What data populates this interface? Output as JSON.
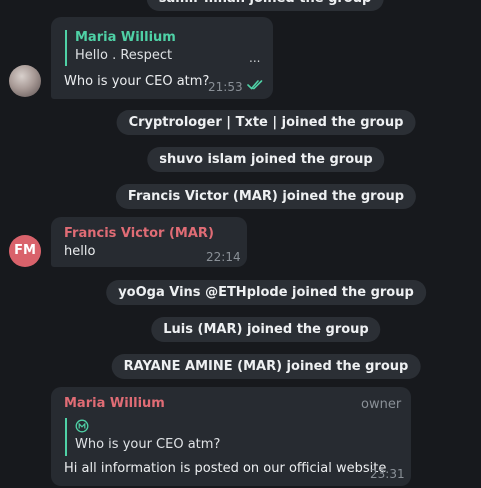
{
  "service": {
    "top_partial": "samir mnan joined the group",
    "msg1": "Cryptrologer | Txte | joined the group",
    "msg2": "shuvo islam joined the group",
    "msg3": "Francis Victor (MAR) joined the group",
    "msg4": "yoOga Vins @ETHplode joined the group",
    "msg5": "Luis (MAR) joined the group",
    "msg6": "RAYANE AMINE (MAR) joined the group"
  },
  "message1": {
    "quote_name": "Maria Willium",
    "quote_text": "Hello . Respect",
    "quote_ellipsis": "...",
    "text": "Who is your CEO atm?",
    "time": "21:53",
    "status_icon": "double-check-icon"
  },
  "message2": {
    "avatar_initials": "FM",
    "sender": "Francis Victor (MAR)",
    "text": "hello",
    "time": "22:14"
  },
  "message3": {
    "sender": "Maria Willium",
    "role": "owner",
    "quote_icon": "coin-icon",
    "quote_text": "Who is your CEO atm?",
    "text": "Hi all information is posted on our official website",
    "time": "23:31"
  },
  "colors": {
    "background": "#17191d",
    "bubble": "#272b31",
    "service_pill": "#2b2f35",
    "maria_accent": "#4fd1a6",
    "francis_accent": "#e06c75",
    "francis_avatar": "#d9626b",
    "check": "#4fd1a6"
  }
}
